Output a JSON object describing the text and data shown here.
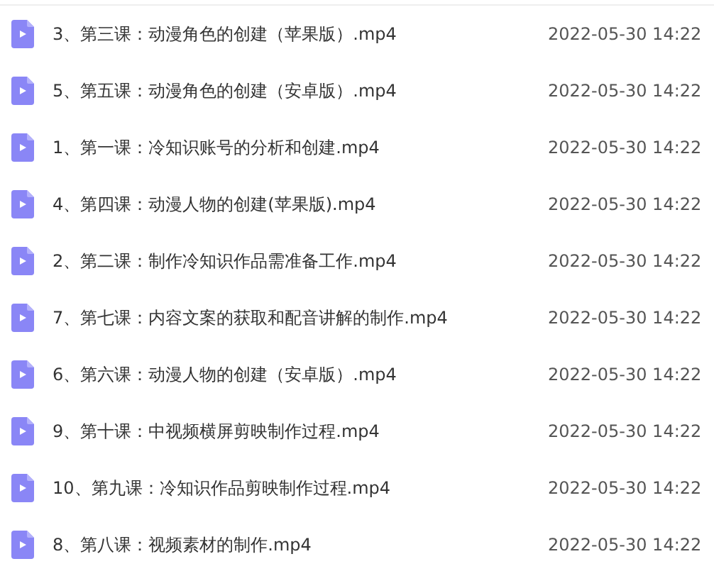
{
  "files": [
    {
      "name": "3、第三课：动漫角色的创建（苹果版）.mp4",
      "modified": "2022-05-30 14:22"
    },
    {
      "name": "5、第五课：动漫角色的创建（安卓版）.mp4",
      "modified": "2022-05-30 14:22"
    },
    {
      "name": "1、第一课：冷知识账号的分析和创建.mp4",
      "modified": "2022-05-30 14:22"
    },
    {
      "name": "4、第四课：动漫人物的创建(苹果版).mp4",
      "modified": "2022-05-30 14:22"
    },
    {
      "name": "2、第二课：制作冷知识作品需准备工作.mp4",
      "modified": "2022-05-30 14:22"
    },
    {
      "name": "7、第七课：内容文案的获取和配音讲解的制作.mp4",
      "modified": "2022-05-30 14:22"
    },
    {
      "name": "6、第六课：动漫人物的创建（安卓版）.mp4",
      "modified": "2022-05-30 14:22"
    },
    {
      "name": "9、第十课：中视频横屏剪映制作过程.mp4",
      "modified": "2022-05-30 14:22"
    },
    {
      "name": "10、第九课：冷知识作品剪映制作过程.mp4",
      "modified": "2022-05-30 14:22"
    },
    {
      "name": "8、第八课：视频素材的制作.mp4",
      "modified": "2022-05-30 14:22"
    }
  ]
}
